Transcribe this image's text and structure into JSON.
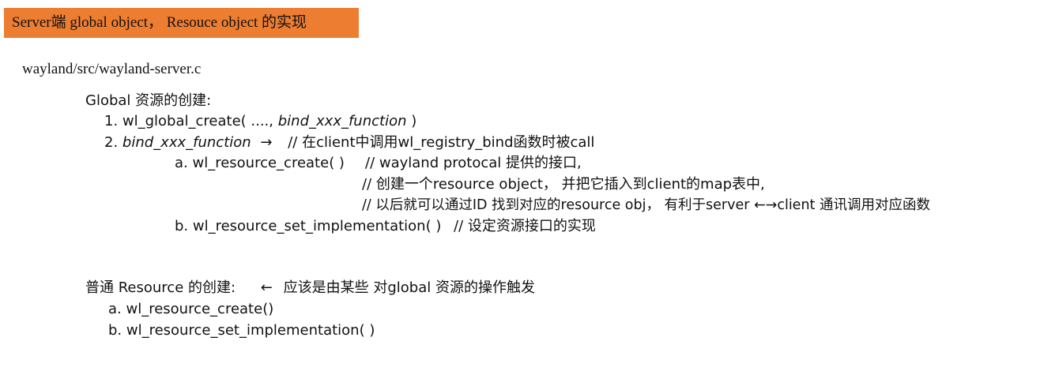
{
  "header": {
    "title": "Server端 global object， Resouce object 的实现"
  },
  "file_path": "wayland/src/wayland-server.c",
  "global_section": {
    "heading": "Global 资源的创建:",
    "step1_prefix": "1. wl_global_create( ....,",
    "step1_func": "bind_xxx_function",
    "step1_suffix": ")",
    "step2_prefix": "2.",
    "step2_func": "bind_xxx_function",
    "step2_arrow": "→",
    "step2_comment": "// 在client中调用wl_registry_bind函数时被call",
    "sub_a": "a. wl_resource_create( )",
    "sub_a_comment": "//  wayland protocal 提供的接口,",
    "comment_line2": "//  创建一个resource object， 并把它插入到client的map表中,",
    "comment_line3": "//  以后就可以通过ID 找到对应的resource obj， 有利于server ←→client 通讯调用对应函数",
    "sub_b": "b. wl_resource_set_implementation( )",
    "sub_b_comment": "// 设定资源接口的实现"
  },
  "normal_section": {
    "heading": "普通 Resource 的创建:",
    "arrow": "←",
    "note": "应该是由某些 对global 资源的操作触发",
    "item_a": "a. wl_resource_create()",
    "item_b": "b. wl_resource_set_implementation( )"
  }
}
